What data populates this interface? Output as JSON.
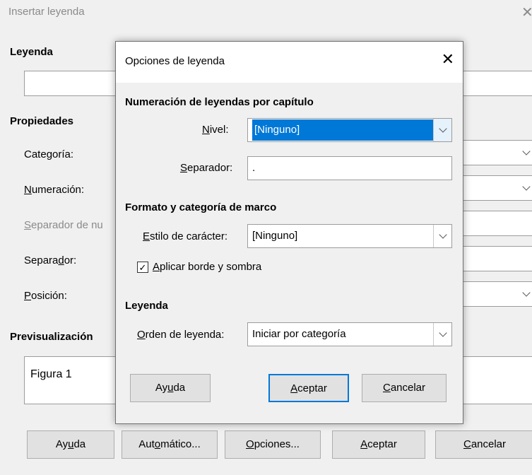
{
  "parent": {
    "title": "Insertar leyenda",
    "leyenda_heading": "Leyenda",
    "leyenda_value": "",
    "propiedades_heading": "Propiedades",
    "categoria_label": "Categoría:",
    "numeracion_label": "Numeración:",
    "separador_num_label": "Separador de nu",
    "separador_label": "Separador:",
    "posicion_label": "Posición:",
    "preview_heading": "Previsualización",
    "preview_text": "Figura 1",
    "buttons": {
      "help": "Ayuda",
      "auto": "Automático...",
      "options": "Opciones...",
      "ok": "Aceptar",
      "cancel": "Cancelar"
    }
  },
  "dialog": {
    "title": "Opciones de leyenda",
    "section_numbering": "Numeración de leyendas por capítulo",
    "nivel_label": "Nivel:",
    "nivel_value": "[Ninguno]",
    "separador_label": "Separador:",
    "separador_value": ".",
    "section_frame": "Formato y categoría de marco",
    "estilo_label": "Estilo de carácter:",
    "estilo_value": "[Ninguno]",
    "checkbox_label": "Aplicar borde y sombra",
    "checkbox_checked": true,
    "section_leyenda": "Leyenda",
    "orden_label": "Orden de leyenda:",
    "orden_value": "Iniciar por categoría",
    "buttons": {
      "help": "Ayuda",
      "ok": "Aceptar",
      "cancel": "Cancelar"
    }
  },
  "colors": {
    "accent": "#0078d7",
    "muted_text": "#8a8a8a",
    "background": "#f0f0f0"
  }
}
